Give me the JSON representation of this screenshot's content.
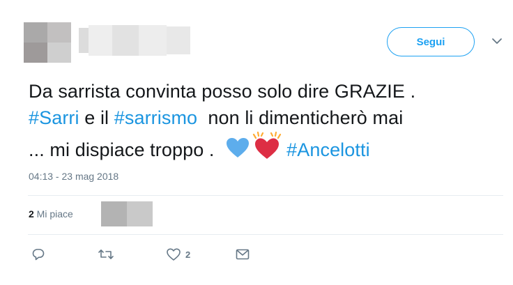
{
  "header": {
    "follow_label": "Segui"
  },
  "tweet": {
    "text_line1": "Da sarrista convinta posso solo dire GRAZIE .",
    "hashtag_sarri": "#Sarri",
    "text_line2_mid": " e il ",
    "hashtag_sarrismo": "#sarrismo",
    "text_line2_end": "  non li dimenticherò mai",
    "text_line3_start": "... mi dispiace troppo . ",
    "hashtag_ancelotti": "#Ancelotti",
    "emoji": [
      "blue-heart-icon",
      "sparkling-heart-icon"
    ]
  },
  "timestamp": "04:13 - 23 mag 2018",
  "stats": {
    "likes_count": "2",
    "likes_label": " Mi piace"
  },
  "actions": {
    "reply_icon": "reply-icon",
    "retweet_icon": "retweet-icon",
    "like_icon": "like-icon",
    "like_count": "2",
    "dm_icon": "direct-message-icon"
  },
  "colors": {
    "accent": "#1da1f2",
    "hashtag": "#1b95e0",
    "muted": "#657786",
    "text": "#14171a",
    "divider": "#e6ecf0"
  }
}
